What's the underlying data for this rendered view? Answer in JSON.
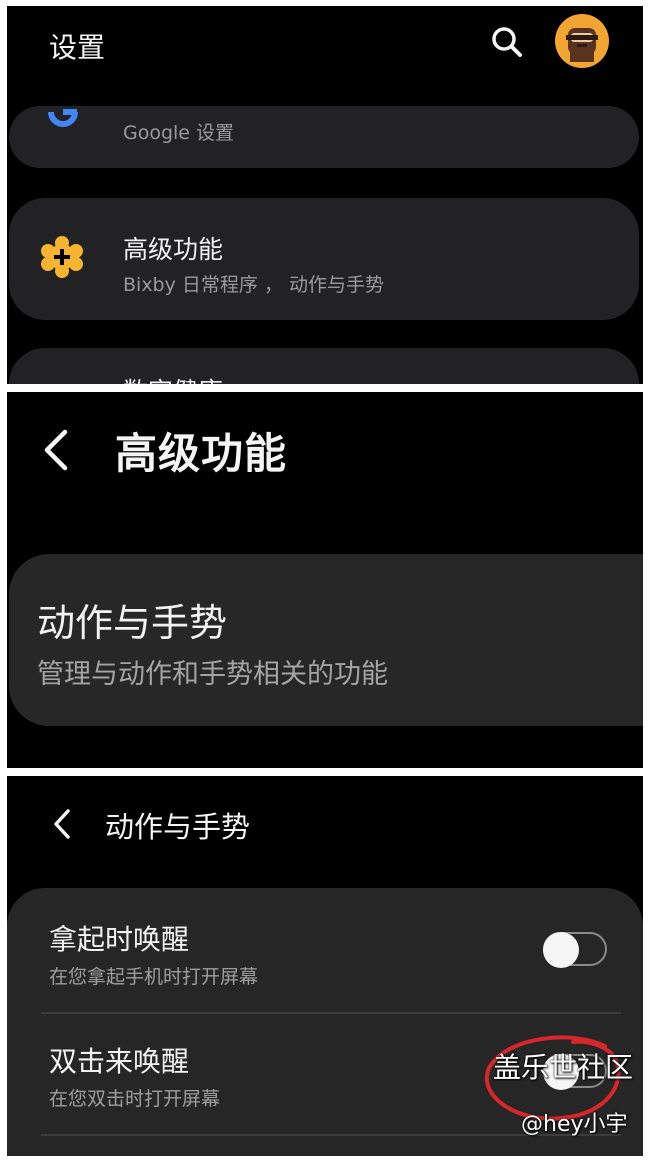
{
  "settings": {
    "title": "设置",
    "google_sub": "Google 设置",
    "advanced_title": "高级功能",
    "advanced_sub": "Bixby 日常程序 ， 动作与手势",
    "partial_label": "数字健康"
  },
  "advanced": {
    "title": "高级功能",
    "motion_title": "动作与手势",
    "motion_sub": "管理与动作和手势相关的功能"
  },
  "motion": {
    "title": "动作与手势",
    "items": [
      {
        "title": "拿起时唤醒",
        "sub": "在您拿起手机时打开屏幕",
        "enabled": false
      },
      {
        "title": "双击来唤醒",
        "sub": "在您双击时打开屏幕",
        "enabled": false
      }
    ]
  },
  "watermark": {
    "line1": "盖乐世社区",
    "line2": "@hey小宇"
  },
  "colors": {
    "background": "#000000",
    "card": "#222224",
    "accent_gear": "#f6b431",
    "circle_annotation": "#d8262a"
  }
}
